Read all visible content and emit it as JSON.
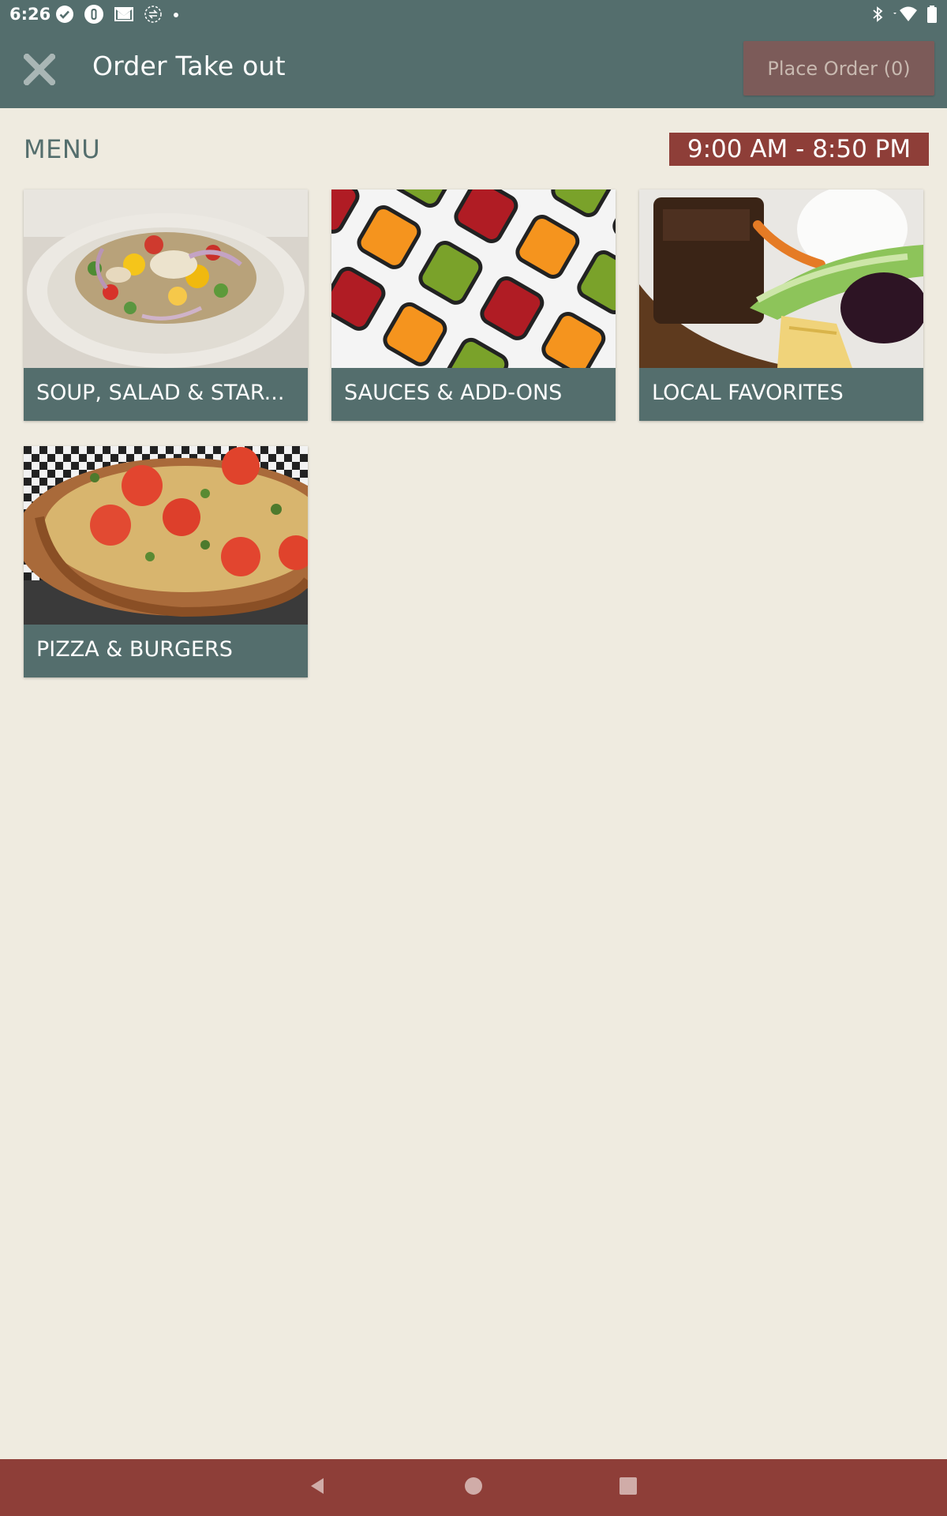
{
  "status_bar": {
    "time": "6:26",
    "left_icons": [
      "check-circle-icon",
      "info-badge-icon",
      "mail-icon",
      "sync-icon",
      "dot-icon"
    ],
    "right_icons": [
      "bluetooth-icon",
      "wifi-icon",
      "battery-icon"
    ]
  },
  "app_bar": {
    "title": "Order Take out",
    "close_icon": "close-icon",
    "place_order_label": "Place Order (0)"
  },
  "menu": {
    "label": "MENU",
    "hours": "9:00 AM - 8:50 PM"
  },
  "categories": [
    {
      "label": "SOUP, SALAD & STAR...",
      "image": "salad-photo"
    },
    {
      "label": "SAUCES & ADD-ONS",
      "image": "sauces-photo"
    },
    {
      "label": "LOCAL FAVORITES",
      "image": "local-favorites-photo"
    },
    {
      "label": "PIZZA & BURGERS",
      "image": "pizza-photo"
    }
  ],
  "colors": {
    "primary": "#546e6d",
    "accent": "#8e3e38",
    "background": "#efebe0",
    "place_order_disabled": "#7c5b59"
  },
  "nav_bar": {
    "buttons": [
      "back-icon",
      "home-icon",
      "recents-icon"
    ]
  }
}
